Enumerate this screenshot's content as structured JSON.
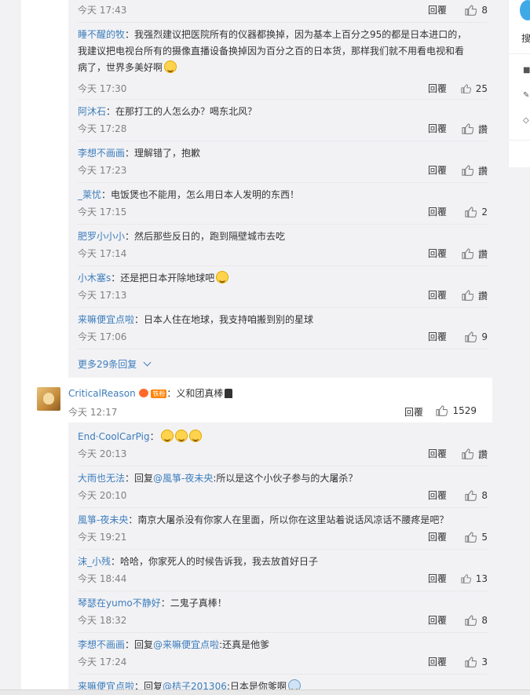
{
  "sub_replies_top": [
    {
      "name": "",
      "text": "",
      "time": "今天 17:43",
      "reply": "回覆",
      "likes": "8"
    },
    {
      "name": "睡不醒的牧",
      "text": "：我强烈建议把医院所有的仪器都换掉，因为基本上百分之95的都是日本进口的，",
      "text2": "我建议把电视台所有的摄像直播设备换掉因为百分之百的日本货，那样我们就不用看电视和看",
      "text3": "病了，世界多美好啊",
      "time": "今天 17:30",
      "reply": "回覆",
      "likes": "25"
    },
    {
      "name": "阿沐石",
      "text": "：在那打工的人怎么办？喝东北风？",
      "time": "今天 17:28",
      "reply": "回覆",
      "likes": "讚"
    },
    {
      "name": "李想不画画",
      "text": "：理解错了，抱歉",
      "time": "今天 17:23",
      "reply": "回覆",
      "likes": "讚"
    },
    {
      "name": "_莱忧",
      "text": "：电饭煲也不能用，怎么用日本人发明的东西！",
      "time": "今天 17:15",
      "reply": "回覆",
      "likes": "2"
    },
    {
      "name": "肥罗小小小",
      "text": "：然后那些反日的，跑到隔壁城市去吃",
      "time": "今天 17:14",
      "reply": "回覆",
      "likes": "讚"
    },
    {
      "name": "小木塞s",
      "text": "：还是把日本开除地球吧",
      "time": "今天 17:13",
      "reply": "回覆",
      "likes": "讚"
    },
    {
      "name": "来嘛便宜点啦",
      "text": "：日本人住在地球，我支持咱搬到别的星球",
      "time": "今天 17:06",
      "reply": "回覆",
      "likes": "9"
    }
  ],
  "more_replies": "更多29条回复",
  "comment": {
    "name": "CriticalReason",
    "badge": "铁粉",
    "text": "：义和团真棒",
    "time": "今天 12:17",
    "reply": "回覆",
    "likes": "1529"
  },
  "sub_replies_bottom": [
    {
      "name": "End·CoolCarPig",
      "text": "：",
      "time": "今天 20:13",
      "reply": "回覆",
      "likes": "讚"
    },
    {
      "name": "大雨也无法",
      "text": "：回复",
      "mention": "@風箏-夜未央",
      "text_after": ":所以是这个小伙子参与的大屠杀？",
      "time": "今天 20:10",
      "reply": "回覆",
      "likes": "8"
    },
    {
      "name": "風箏-夜未央",
      "text": "：南京大屠杀没有你家人在里面，所以你在这里站着说话风凉话不腰疼是吧？",
      "time": "今天 19:21",
      "reply": "回覆",
      "likes": "5"
    },
    {
      "name": "沫_小残",
      "text": "：哈哈，你家死人的时候告诉我，我去放首好日子",
      "time": "今天 18:44",
      "reply": "回覆",
      "likes": "13"
    },
    {
      "name": "琴瑟在yumo不静好",
      "text": "：二鬼子真棒！",
      "time": "今天 18:32",
      "reply": "回覆",
      "likes": "8"
    },
    {
      "name": "李想不画画",
      "text": "：回复",
      "mention": "@来嘛便宜点啦",
      "text_after": ":还真是他爹",
      "time": "今天 17:24",
      "reply": "回覆",
      "likes": "3"
    },
    {
      "name": "来嘛便宜点啦",
      "text": "：回复",
      "mention": "@桔子201306",
      "text_after": ":日本是你爹啊",
      "time": "",
      "reply": "",
      "likes": ""
    }
  ],
  "right_panel": {
    "search_label": "搜"
  }
}
